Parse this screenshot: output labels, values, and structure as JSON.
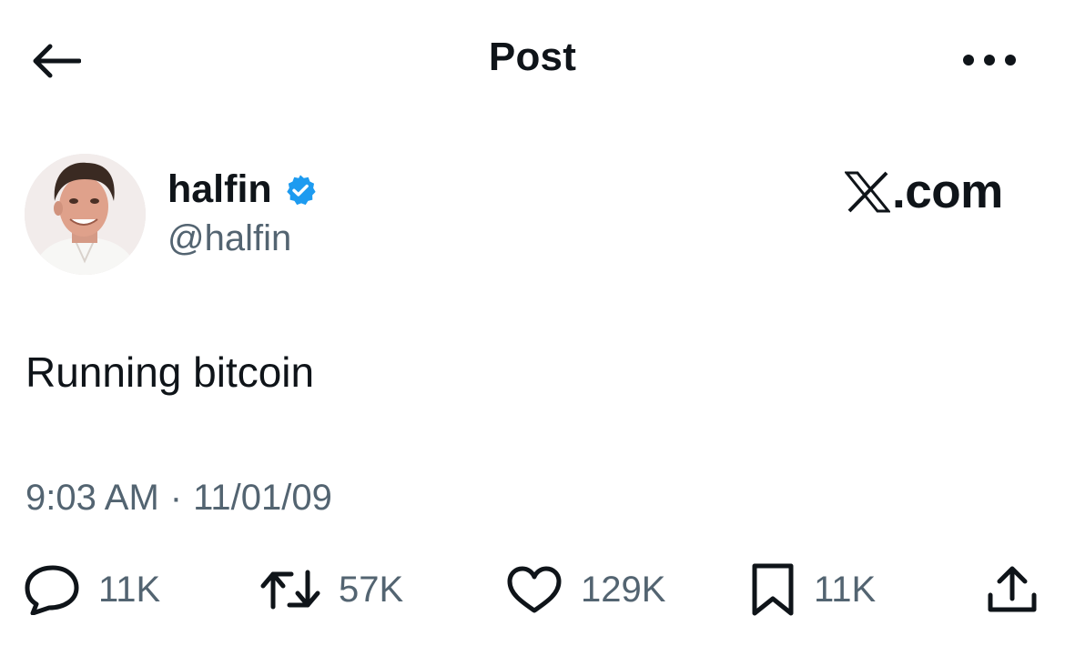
{
  "header": {
    "title": "Post",
    "back_icon": "arrow-left-icon",
    "more_icon": "more-horizontal-icon"
  },
  "author": {
    "name": "halfin",
    "handle": "@halfin",
    "verified": true,
    "verified_color": "#1d9bf0"
  },
  "brand": {
    "text": ".com"
  },
  "post": {
    "text": "Running bitcoin",
    "time": "9:03 AM",
    "separator": "·",
    "date": "11/01/09"
  },
  "actions": {
    "reply": {
      "icon": "reply-icon",
      "count": "11K"
    },
    "retweet": {
      "icon": "retweet-icon",
      "count": "57K"
    },
    "like": {
      "icon": "heart-icon",
      "count": "129K"
    },
    "bookmark": {
      "icon": "bookmark-icon",
      "count": "11K"
    },
    "share": {
      "icon": "share-icon"
    }
  },
  "colors": {
    "text_primary": "#0f1419",
    "text_secondary": "#536471",
    "background": "#ffffff"
  }
}
